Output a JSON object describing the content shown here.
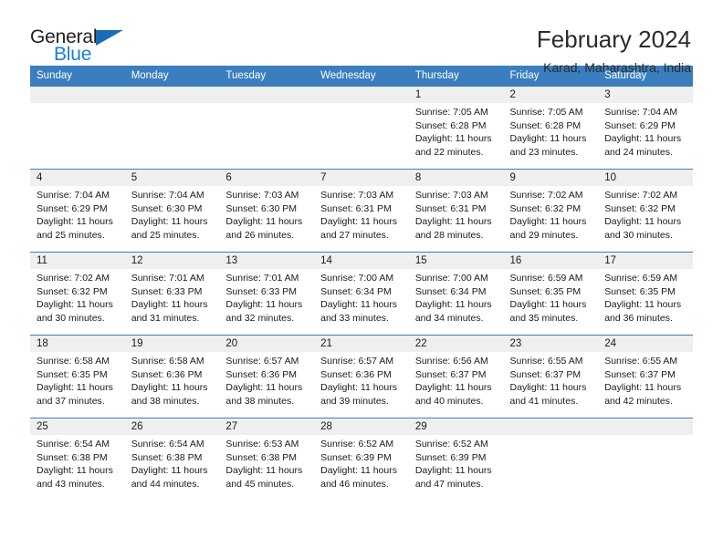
{
  "brand": {
    "word_top": "General",
    "word_bottom": "Blue",
    "triangle_color": "#1b6cb5",
    "blue_color": "#1b7fd4"
  },
  "header": {
    "title": "February 2024",
    "subtitle": "Karad, Maharashtra, India"
  },
  "theme": {
    "header_bg": "#3a7ebf",
    "header_text": "#ffffff",
    "date_band_bg": "#efefef",
    "cell_bg": "#ffffff",
    "grid_line": "#3a7ebf"
  },
  "weekdays": [
    "Sunday",
    "Monday",
    "Tuesday",
    "Wednesday",
    "Thursday",
    "Friday",
    "Saturday"
  ],
  "labels": {
    "sunrise_prefix": "Sunrise:",
    "sunset_prefix": "Sunset:",
    "daylight_prefix": "Daylight:"
  },
  "weeks": [
    [
      {
        "date": "",
        "sunrise": "",
        "sunset": "",
        "daylight_line1": "",
        "daylight_line2": ""
      },
      {
        "date": "",
        "sunrise": "",
        "sunset": "",
        "daylight_line1": "",
        "daylight_line2": ""
      },
      {
        "date": "",
        "sunrise": "",
        "sunset": "",
        "daylight_line1": "",
        "daylight_line2": ""
      },
      {
        "date": "",
        "sunrise": "",
        "sunset": "",
        "daylight_line1": "",
        "daylight_line2": ""
      },
      {
        "date": "1",
        "sunrise": "Sunrise: 7:05 AM",
        "sunset": "Sunset: 6:28 PM",
        "daylight_line1": "Daylight: 11 hours",
        "daylight_line2": "and 22 minutes."
      },
      {
        "date": "2",
        "sunrise": "Sunrise: 7:05 AM",
        "sunset": "Sunset: 6:28 PM",
        "daylight_line1": "Daylight: 11 hours",
        "daylight_line2": "and 23 minutes."
      },
      {
        "date": "3",
        "sunrise": "Sunrise: 7:04 AM",
        "sunset": "Sunset: 6:29 PM",
        "daylight_line1": "Daylight: 11 hours",
        "daylight_line2": "and 24 minutes."
      }
    ],
    [
      {
        "date": "4",
        "sunrise": "Sunrise: 7:04 AM",
        "sunset": "Sunset: 6:29 PM",
        "daylight_line1": "Daylight: 11 hours",
        "daylight_line2": "and 25 minutes."
      },
      {
        "date": "5",
        "sunrise": "Sunrise: 7:04 AM",
        "sunset": "Sunset: 6:30 PM",
        "daylight_line1": "Daylight: 11 hours",
        "daylight_line2": "and 25 minutes."
      },
      {
        "date": "6",
        "sunrise": "Sunrise: 7:03 AM",
        "sunset": "Sunset: 6:30 PM",
        "daylight_line1": "Daylight: 11 hours",
        "daylight_line2": "and 26 minutes."
      },
      {
        "date": "7",
        "sunrise": "Sunrise: 7:03 AM",
        "sunset": "Sunset: 6:31 PM",
        "daylight_line1": "Daylight: 11 hours",
        "daylight_line2": "and 27 minutes."
      },
      {
        "date": "8",
        "sunrise": "Sunrise: 7:03 AM",
        "sunset": "Sunset: 6:31 PM",
        "daylight_line1": "Daylight: 11 hours",
        "daylight_line2": "and 28 minutes."
      },
      {
        "date": "9",
        "sunrise": "Sunrise: 7:02 AM",
        "sunset": "Sunset: 6:32 PM",
        "daylight_line1": "Daylight: 11 hours",
        "daylight_line2": "and 29 minutes."
      },
      {
        "date": "10",
        "sunrise": "Sunrise: 7:02 AM",
        "sunset": "Sunset: 6:32 PM",
        "daylight_line1": "Daylight: 11 hours",
        "daylight_line2": "and 30 minutes."
      }
    ],
    [
      {
        "date": "11",
        "sunrise": "Sunrise: 7:02 AM",
        "sunset": "Sunset: 6:32 PM",
        "daylight_line1": "Daylight: 11 hours",
        "daylight_line2": "and 30 minutes."
      },
      {
        "date": "12",
        "sunrise": "Sunrise: 7:01 AM",
        "sunset": "Sunset: 6:33 PM",
        "daylight_line1": "Daylight: 11 hours",
        "daylight_line2": "and 31 minutes."
      },
      {
        "date": "13",
        "sunrise": "Sunrise: 7:01 AM",
        "sunset": "Sunset: 6:33 PM",
        "daylight_line1": "Daylight: 11 hours",
        "daylight_line2": "and 32 minutes."
      },
      {
        "date": "14",
        "sunrise": "Sunrise: 7:00 AM",
        "sunset": "Sunset: 6:34 PM",
        "daylight_line1": "Daylight: 11 hours",
        "daylight_line2": "and 33 minutes."
      },
      {
        "date": "15",
        "sunrise": "Sunrise: 7:00 AM",
        "sunset": "Sunset: 6:34 PM",
        "daylight_line1": "Daylight: 11 hours",
        "daylight_line2": "and 34 minutes."
      },
      {
        "date": "16",
        "sunrise": "Sunrise: 6:59 AM",
        "sunset": "Sunset: 6:35 PM",
        "daylight_line1": "Daylight: 11 hours",
        "daylight_line2": "and 35 minutes."
      },
      {
        "date": "17",
        "sunrise": "Sunrise: 6:59 AM",
        "sunset": "Sunset: 6:35 PM",
        "daylight_line1": "Daylight: 11 hours",
        "daylight_line2": "and 36 minutes."
      }
    ],
    [
      {
        "date": "18",
        "sunrise": "Sunrise: 6:58 AM",
        "sunset": "Sunset: 6:35 PM",
        "daylight_line1": "Daylight: 11 hours",
        "daylight_line2": "and 37 minutes."
      },
      {
        "date": "19",
        "sunrise": "Sunrise: 6:58 AM",
        "sunset": "Sunset: 6:36 PM",
        "daylight_line1": "Daylight: 11 hours",
        "daylight_line2": "and 38 minutes."
      },
      {
        "date": "20",
        "sunrise": "Sunrise: 6:57 AM",
        "sunset": "Sunset: 6:36 PM",
        "daylight_line1": "Daylight: 11 hours",
        "daylight_line2": "and 38 minutes."
      },
      {
        "date": "21",
        "sunrise": "Sunrise: 6:57 AM",
        "sunset": "Sunset: 6:36 PM",
        "daylight_line1": "Daylight: 11 hours",
        "daylight_line2": "and 39 minutes."
      },
      {
        "date": "22",
        "sunrise": "Sunrise: 6:56 AM",
        "sunset": "Sunset: 6:37 PM",
        "daylight_line1": "Daylight: 11 hours",
        "daylight_line2": "and 40 minutes."
      },
      {
        "date": "23",
        "sunrise": "Sunrise: 6:55 AM",
        "sunset": "Sunset: 6:37 PM",
        "daylight_line1": "Daylight: 11 hours",
        "daylight_line2": "and 41 minutes."
      },
      {
        "date": "24",
        "sunrise": "Sunrise: 6:55 AM",
        "sunset": "Sunset: 6:37 PM",
        "daylight_line1": "Daylight: 11 hours",
        "daylight_line2": "and 42 minutes."
      }
    ],
    [
      {
        "date": "25",
        "sunrise": "Sunrise: 6:54 AM",
        "sunset": "Sunset: 6:38 PM",
        "daylight_line1": "Daylight: 11 hours",
        "daylight_line2": "and 43 minutes."
      },
      {
        "date": "26",
        "sunrise": "Sunrise: 6:54 AM",
        "sunset": "Sunset: 6:38 PM",
        "daylight_line1": "Daylight: 11 hours",
        "daylight_line2": "and 44 minutes."
      },
      {
        "date": "27",
        "sunrise": "Sunrise: 6:53 AM",
        "sunset": "Sunset: 6:38 PM",
        "daylight_line1": "Daylight: 11 hours",
        "daylight_line2": "and 45 minutes."
      },
      {
        "date": "28",
        "sunrise": "Sunrise: 6:52 AM",
        "sunset": "Sunset: 6:39 PM",
        "daylight_line1": "Daylight: 11 hours",
        "daylight_line2": "and 46 minutes."
      },
      {
        "date": "29",
        "sunrise": "Sunrise: 6:52 AM",
        "sunset": "Sunset: 6:39 PM",
        "daylight_line1": "Daylight: 11 hours",
        "daylight_line2": "and 47 minutes."
      },
      {
        "date": "",
        "sunrise": "",
        "sunset": "",
        "daylight_line1": "",
        "daylight_line2": ""
      },
      {
        "date": "",
        "sunrise": "",
        "sunset": "",
        "daylight_line1": "",
        "daylight_line2": ""
      }
    ]
  ]
}
